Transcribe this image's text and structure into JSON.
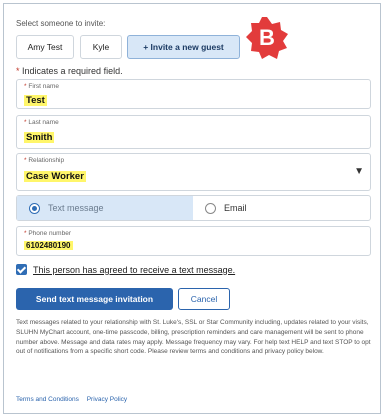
{
  "invite": {
    "label": "Select someone to invite:",
    "guests": [
      "Amy Test",
      "Kyle",
      "+ Invite a new guest"
    ]
  },
  "badge": {
    "letter": "B",
    "color": "#e23b3b"
  },
  "required_note": "Indicates a required field.",
  "form": {
    "first_name": {
      "label": "First name",
      "value": "Test"
    },
    "last_name": {
      "label": "Last name",
      "value": "Smith"
    },
    "relationship": {
      "label": "Relationship",
      "value": "Case Worker",
      "icon": "chevron-down-icon"
    },
    "contact_method": {
      "options": [
        "Text message",
        "Email"
      ],
      "selected": "Text message"
    },
    "phone": {
      "label": "Phone number",
      "value": "6102480190"
    }
  },
  "consent": {
    "label": "This person has agreed to receive a text message.",
    "checked": true
  },
  "buttons": {
    "send": "Send text message invitation",
    "cancel": "Cancel"
  },
  "disclaimer": "Text messages related to your relationship with St. Luke's, SSL or Star Community including, updates related to your visits, SLUHN MyChart account, one-time passcode, billing, prescription reminders and care management will be sent to phone number above. Message and data rates may apply. Message frequency may vary. For help text HELP and text STOP to opt out of notifications from a specific short code. Please review terms and conditions and privacy policy below.",
  "links": [
    "Terms and Conditions",
    "Privacy Policy"
  ],
  "colors": {
    "accent": "#2b64ad",
    "highlight": "#fff66a",
    "selected_bg": "#d8e7f7",
    "badge": "#e23b3b"
  }
}
